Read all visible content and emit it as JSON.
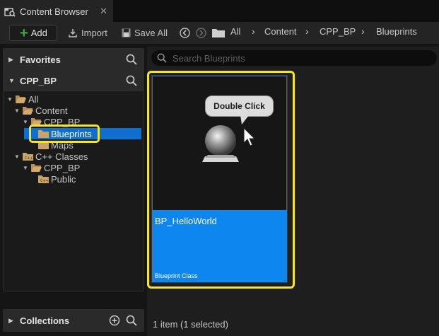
{
  "window": {
    "tab_title": "Content Browser",
    "close_glyph": "✕"
  },
  "toolbar": {
    "add_label": "Add",
    "import_label": "Import",
    "save_all_label": "Save All",
    "breadcrumbs": [
      "All",
      "Content",
      "CPP_BP",
      "Blueprints"
    ]
  },
  "sidebar": {
    "favorites_label": "Favorites",
    "project_label": "CPP_BP",
    "collections_label": "Collections",
    "tree": [
      {
        "label": "All",
        "icon": "folder-open-icon",
        "expanded": true
      },
      {
        "label": "Content",
        "icon": "folder-open-icon",
        "expanded": true
      },
      {
        "label": "CPP_BP",
        "icon": "folder-open-icon",
        "expanded": true
      },
      {
        "label": "Blueprints",
        "icon": "folder-icon",
        "selected": true
      },
      {
        "label": "Maps",
        "icon": "folder-icon"
      },
      {
        "label": "C++ Classes",
        "icon": "cpp-folder-icon",
        "expanded": true
      },
      {
        "label": "CPP_BP",
        "icon": "cpp-folder-icon",
        "expanded": true
      },
      {
        "label": "Public",
        "icon": "cpp-folder-icon"
      }
    ]
  },
  "content": {
    "search_placeholder": "Search Blueprints",
    "asset": {
      "name": "BP_HelloWorld",
      "type": "Blueprint Class"
    },
    "tooltip": "Double Click",
    "status": "1 item (1 selected)"
  },
  "colors": {
    "selection": "#0f6fd1",
    "asset_info_bg": "#0e86f0",
    "highlight": "#f5e62a",
    "add_plus": "#3fa83f",
    "folder": "#c9a46a"
  }
}
